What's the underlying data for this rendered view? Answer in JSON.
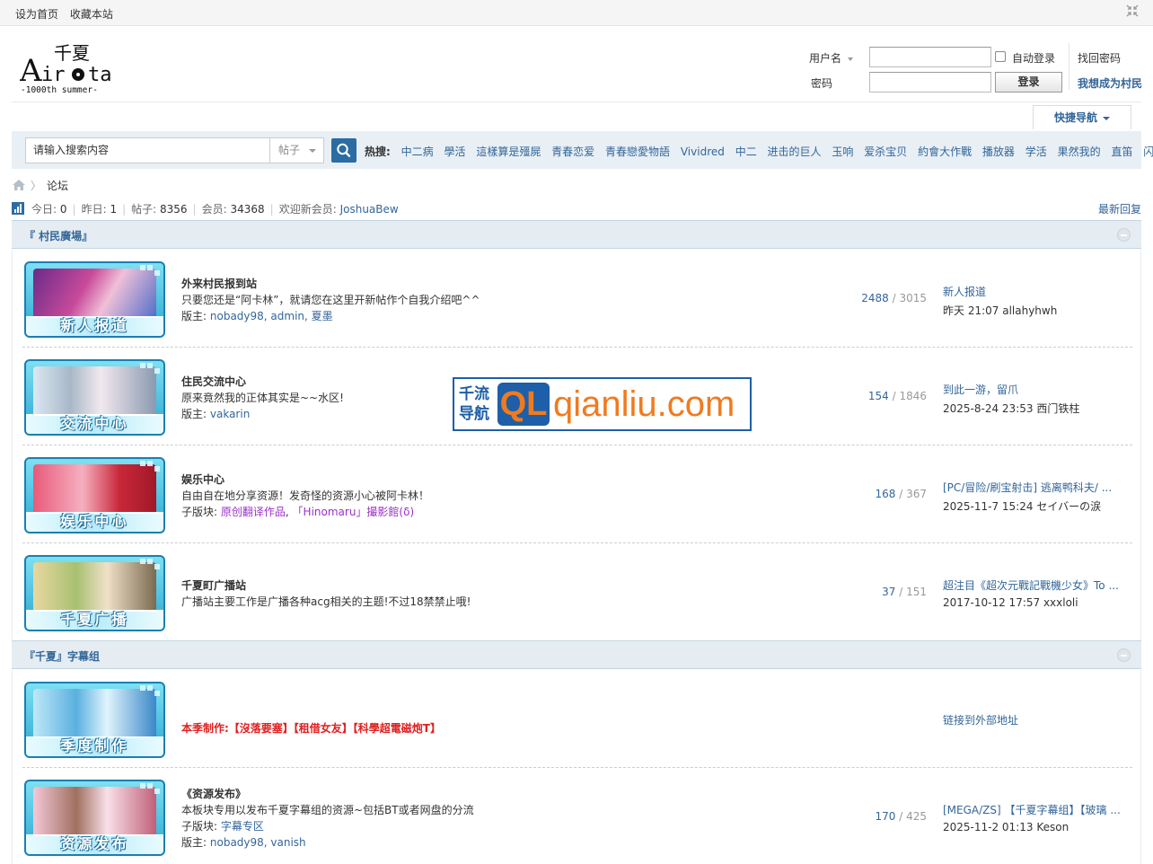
{
  "topbar": {
    "set_home": "设为首页",
    "bookmark": "收藏本站"
  },
  "logo": {
    "cn": "千夏",
    "latin": "Air ta",
    "sub": "-1000th summer-"
  },
  "login": {
    "username_label": "用户名",
    "password_label": "密码",
    "auto_login": "自动登录",
    "login_button": "登录",
    "find_password": "找回密码",
    "register": "我想成为村民"
  },
  "quick_nav": "快捷导航",
  "search": {
    "placeholder": "请输入搜索内容",
    "type": "帖子",
    "hot_label": "热搜:",
    "hot_keywords": [
      "中二病",
      "學活",
      "這樣算是殭屍",
      "青春恋爱",
      "青春戀愛物語",
      "Vividred",
      "中二",
      "进击的巨人",
      "玉响",
      "爱杀宝贝",
      "約會大作戰",
      "播放器",
      "学活",
      "果然我的",
      "直笛",
      "闪乱神乐"
    ]
  },
  "breadcrumb": {
    "current": "论坛"
  },
  "stats": {
    "today_label": "今日:",
    "today": "0",
    "yesterday_label": "昨日:",
    "yesterday": "1",
    "posts_label": "帖子:",
    "posts": "8356",
    "members_label": "会员:",
    "members": "34368",
    "newest_label": "欢迎新会员:",
    "newest": "JoshuaBew",
    "latest_replies": "最新回复"
  },
  "categories": [
    {
      "title": "『 村民廣場』",
      "forums": [
        {
          "thumb": "新人报道",
          "name": "外来村民报到站",
          "desc": "只要您还是“阿卡林”，就请您在这里开新帖作个自我介绍吧^^",
          "mod_label": "版主:",
          "mods": "nobady98, admin, 夏墨",
          "threads": "2488",
          "posts": "3015",
          "last_title": "新人报道",
          "last_meta": "昨天 21:07 allahyhwh"
        },
        {
          "thumb": "交流中心",
          "name": "住民交流中心",
          "desc": "原来竟然我的正体其实是~~水区!",
          "mod_label": "版主:",
          "mods": "vakarin",
          "threads": "154",
          "posts": "1846",
          "last_title": "到此一游，留爪",
          "last_meta": "2025-8-24 23:53 西门铁柱"
        },
        {
          "thumb": "娱乐中心",
          "name": "娱乐中心",
          "desc": "自由自在地分享资源！发奇怪的资源小心被阿卡林！",
          "mod_label": "子版块:",
          "sub1": "原创翻译作品",
          "sub_sep": ",",
          "sub2": "「Hinomaru」撮影館(δ)",
          "threads": "168",
          "posts": "367",
          "last_title": "[PC/冒险/刷宝射击] 逃离鸭科夫/ ...",
          "last_meta": "2025-11-7 15:24 セイバーの涙"
        },
        {
          "thumb": "千夏广播",
          "name": "千夏町广播站",
          "desc": "广播站主要工作是广播各种acg相关的主题!不过18禁禁止哦!",
          "threads": "37",
          "posts": "151",
          "last_title": "超注目《超次元戰記戰機少女》To ...",
          "last_meta": "2017-10-12 17:57 xxxloli"
        }
      ]
    },
    {
      "title": "『千夏』字幕组",
      "forums": [
        {
          "thumb": "季度制作",
          "name": "本季制作:【沒落要塞】【租借女友】【科學超電磁炮T】",
          "last_title": "链接到外部地址"
        },
        {
          "thumb": "资源发布",
          "name": "《资源发布》",
          "desc": "本板块专用以发布千夏字幕组的资源~包括BT或者网盘的分流",
          "sub_label": "子版块:",
          "sub": "字幕专区",
          "mod_label": "版主:",
          "mods": "nobady98, vanish",
          "threads": "170",
          "posts": "425",
          "last_title": "[MEGA/ZS] 【千夏字幕组】【玻璃 ...",
          "last_meta": "2025-11-2 01:13 Keson"
        }
      ]
    }
  ],
  "watermark": {
    "cn_line1": "千流",
    "cn_line2": "导航",
    "badge": "QL",
    "domain": "qianliu.com"
  },
  "colors": {
    "link": "#336699",
    "category_bg": "#e5edf2",
    "search_bg": "#e8eff5",
    "search_button": "#2b6ca3",
    "highlight_red": "#e02020",
    "sub_purple": "#9b30c8"
  }
}
